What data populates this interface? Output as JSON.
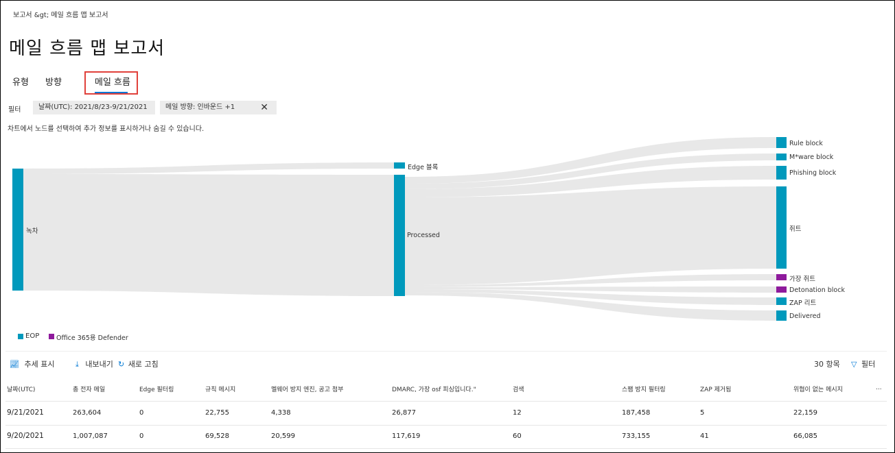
{
  "breadcrumb": "보고서 &gt;  메일 흐름 맵 보고서",
  "title": "메일 흐름 맵 보고서",
  "tabs": [
    {
      "label": "유형"
    },
    {
      "label": "방향"
    },
    {
      "label": "메일 흐름",
      "active": true
    }
  ],
  "filters": {
    "label": "필터",
    "date": "날짜(UTC): 2021/8/23-9/21/2021",
    "direction": "메일 방향: 인바운드 +1"
  },
  "hint": "차트에서 노드를 선택하여 추가 정보를 표시하거나 숨길 수 있습니다.",
  "sankey": {
    "source": "녹차",
    "middle": [
      "Edge 블록",
      "Processed"
    ],
    "targets": [
      "Rule block",
      "M*ware block",
      "Phishing block",
      "쥐트",
      "가장 쥐트",
      "Detonation block",
      "ZAP 리트",
      "Delivered"
    ]
  },
  "legend": [
    {
      "label": "EOP",
      "color": "#0099bc"
    },
    {
      "label": "Office 365용 Defender",
      "color": "#8e1a9c"
    }
  ],
  "toolbar": {
    "trend": "추세 표시",
    "export": "내보내기",
    "refresh": "새로 고침",
    "count": "30 항목",
    "filter": "필터"
  },
  "table": {
    "headers": [
      "날짜(UTC)",
      "총 전자 메일",
      "Edge 필터링",
      "규칙 메시지",
      "멜웨어 방지 엔진, 공고 첨부",
      "DMARC, 가장 osf 피싱입니다.\"",
      "검색",
      "스팸 방지 필터링",
      "ZAP 제거됨",
      "위협이 없는 메시지",
      "..."
    ],
    "rows": [
      [
        "9/21/2021",
        "263,604",
        "0",
        "22,755",
        "4,338",
        "26,877",
        "12",
        "187,458",
        "5",
        "22,159"
      ],
      [
        "9/20/2021",
        "1,007,087",
        "0",
        "69,528",
        "20,599",
        "117,619",
        "60",
        "733,155",
        "41",
        "66,085"
      ]
    ]
  }
}
